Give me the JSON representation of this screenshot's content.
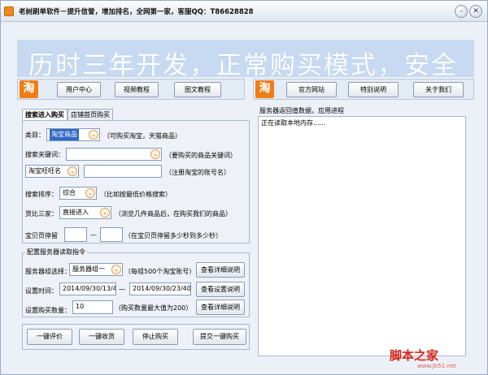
{
  "window": {
    "title": "老树刷单软件－提升信誉，增加排名，全网第一家，客服QQ：T86628828",
    "minimize_glyph": "–",
    "close_glyph": "✕",
    "accent": "#f27c16"
  },
  "banner": {
    "text": "历时三年开发，正常购买模式，安全"
  },
  "nav_left": {
    "logo": "淘",
    "buttons": [
      "用户中心",
      "视频教程",
      "图文教程"
    ]
  },
  "nav_right": {
    "logo": "淘",
    "buttons": [
      "官方网站",
      "特别说明",
      "关于我们"
    ]
  },
  "tabs": {
    "active": "搜索进入购买",
    "inactive": "店铺首页购买"
  },
  "search_form": {
    "category_label": "类目：",
    "category_value": "淘宝商品",
    "category_hint": "（可购买淘宝，天猫商品）",
    "keyword_label": "搜索关键词：",
    "keyword_hint": "（要购买的商品关键词）",
    "account_select": "淘宝旺旺名",
    "account_hint": "（注册淘宝的账号名）",
    "sort_label": "搜索排序：",
    "sort_value": "综合",
    "sort_hint": "（比如按最低价格搜索）",
    "compare_label": "货比三家：",
    "compare_value": "直接进入",
    "compare_hint": "（浏览几件商品后，在购买我们的商品）",
    "stay_label": "宝贝页停留",
    "stay_separator": "—",
    "stay_hint": "（在宝贝页停留多少秒到多少秒）"
  },
  "server_config": {
    "group_title": "配置服务器读取指令",
    "group_label": "服务器组选择：",
    "group_value": "服务器组一",
    "group_hint": "（每组500个淘宝账号）",
    "group_detail_button": "查看详细说明",
    "time_label": "设置时间：",
    "time_start": "2014/09/30/13/40",
    "time_separator": "—",
    "time_end": "2014/09/30/23/40",
    "time_detail_button": "查看设置说明",
    "qty_label": "设置购买数量：",
    "qty_value": "10",
    "qty_hint": "（购买数量最大值为200）",
    "qty_detail_button": "查看详细说明"
  },
  "actions": [
    "一键评价",
    "一键收货",
    "停止购买",
    "提交一键购买"
  ],
  "log": {
    "title": "服务器返回值数据，应用进程",
    "lines": [
      "正在读取本地内存......"
    ]
  },
  "watermark": {
    "text": "脚本之家",
    "url": "www.jb51.net"
  }
}
